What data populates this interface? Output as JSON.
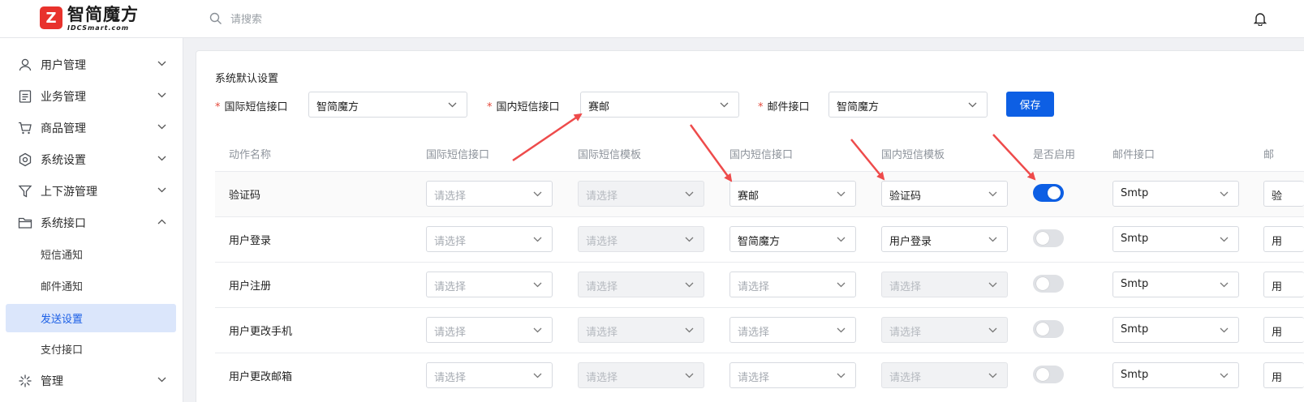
{
  "header": {
    "logo_text": "智简魔方",
    "logo_subtext": "IDCSmart.com",
    "logo_mark": "Z",
    "search_placeholder": "请搜索",
    "search_icon": "search-icon",
    "bell_icon": "bell-icon"
  },
  "sidebar": {
    "items": [
      {
        "label": "用户管理",
        "icon": "user-icon",
        "expanded": false
      },
      {
        "label": "业务管理",
        "icon": "document-icon",
        "expanded": false
      },
      {
        "label": "商品管理",
        "icon": "cart-icon",
        "expanded": false
      },
      {
        "label": "系统设置",
        "icon": "settings-icon",
        "expanded": false
      },
      {
        "label": "上下游管理",
        "icon": "funnel-icon",
        "expanded": false
      },
      {
        "label": "系统接口",
        "icon": "folder-icon",
        "expanded": true
      },
      {
        "label": "管理",
        "icon": "asterisk-icon",
        "expanded": false
      }
    ],
    "sub_items": [
      {
        "label": "短信通知",
        "active": false
      },
      {
        "label": "邮件通知",
        "active": false
      },
      {
        "label": "发送设置",
        "active": true
      },
      {
        "label": "支付接口",
        "active": false
      }
    ]
  },
  "defaults": {
    "title": "系统默认设置",
    "required_mark": "*",
    "intl_sms_label": "国际短信接口",
    "intl_sms_value": "智简魔方",
    "domestic_sms_label": "国内短信接口",
    "domestic_sms_value": "赛邮",
    "email_label": "邮件接口",
    "email_value": "智简魔方",
    "save_label": "保存"
  },
  "table": {
    "headers": [
      "动作名称",
      "国际短信接口",
      "国际短信模板",
      "国内短信接口",
      "国内短信模板",
      "是否启用",
      "邮件接口",
      "邮"
    ],
    "placeholder": "请选择",
    "rows": [
      {
        "name": "验证码",
        "intl_iface": "请选择",
        "intl_tpl": "请选择",
        "dom_iface": "赛邮",
        "dom_tpl": "验证码",
        "enabled": true,
        "email": "Smtp",
        "extra": "验"
      },
      {
        "name": "用户登录",
        "intl_iface": "请选择",
        "intl_tpl": "请选择",
        "dom_iface": "智简魔方",
        "dom_tpl": "用户登录",
        "enabled": false,
        "email": "Smtp",
        "extra": "用"
      },
      {
        "name": "用户注册",
        "intl_iface": "请选择",
        "intl_tpl": "请选择",
        "dom_iface": "请选择",
        "dom_tpl": "请选择",
        "enabled": false,
        "email": "Smtp",
        "extra": "用"
      },
      {
        "name": "用户更改手机",
        "intl_iface": "请选择",
        "intl_tpl": "请选择",
        "dom_iface": "请选择",
        "dom_tpl": "请选择",
        "enabled": false,
        "email": "Smtp",
        "extra": "用"
      },
      {
        "name": "用户更改邮箱",
        "intl_iface": "请选择",
        "intl_tpl": "请选择",
        "dom_iface": "请选择",
        "dom_tpl": "请选择",
        "enabled": false,
        "email": "Smtp",
        "extra": "用"
      }
    ]
  },
  "colors": {
    "accent": "#0d5fe4",
    "annotation_arrow": "#ee4b4b",
    "logo_red": "#e8322c",
    "active_nav_bg": "#dbe6fb"
  }
}
